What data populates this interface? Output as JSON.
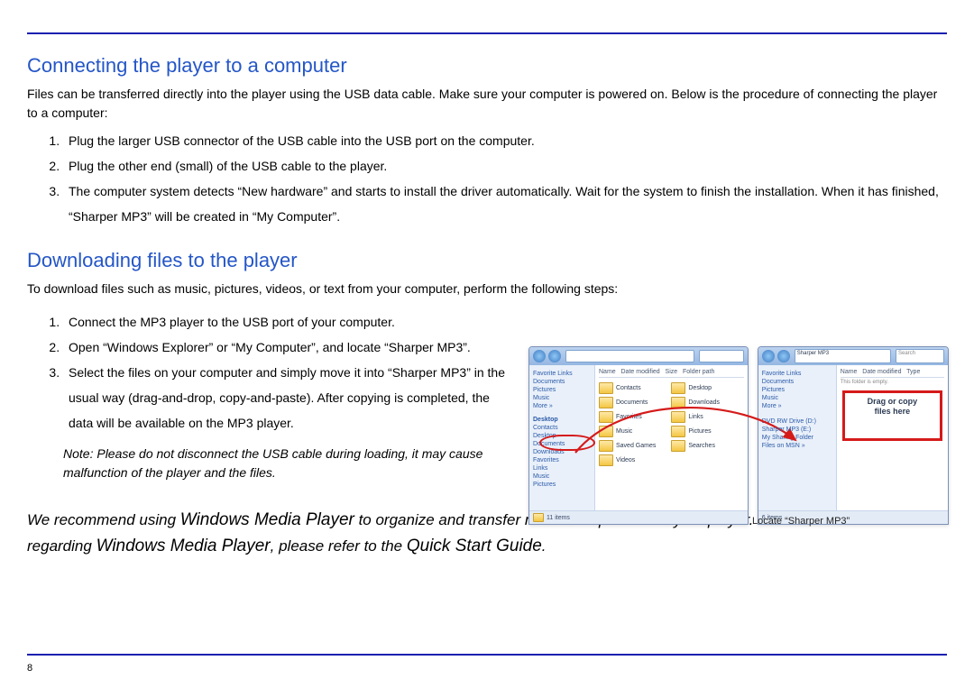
{
  "page_number": "8",
  "section1": {
    "heading": "Connecting the player to a computer",
    "intro": "Files can be transferred directly into the player using the USB data cable. Make sure your computer is powered on. Below is the procedure of connecting the player to a computer:",
    "steps": [
      "Plug the larger USB connector of the USB cable into the USB port on the computer.",
      "Plug the other end (small) of the USB cable to the player.",
      "The computer system detects “New hardware” and starts to install the driver automatically. Wait for the system to finish the installation. When it has finished, “Sharper MP3” will be created in “My Computer”."
    ]
  },
  "section2": {
    "heading": "Downloading files to the player",
    "intro": "To download files such as music, pictures, videos, or text from your computer, perform the following steps:",
    "steps": [
      "Connect the MP3 player to the USB port of your computer.",
      "Open “Windows Explorer” or “My Computer”, and locate “Sharper MP3”.",
      "Select the files on your computer and simply move it into “Sharper MP3” in the usual way (drag-and-drop, copy-and-paste).  After copying is completed, the data will be available on the MP3 player."
    ],
    "note_label": "Note:",
    "note_body": " Please do not disconnect the USB cable during loading, it  may cause malfunction of the player and the files."
  },
  "recommend": {
    "pre": "We recommend using ",
    "wmp1": "Windows Media Player",
    "mid1": " to organize and transfer music and pictures to your player. For more information regarding ",
    "wmp2": "Windows Media Player",
    "mid2": ", please refer to the ",
    "qsg": "Quick Start Guide",
    "tail": "."
  },
  "screenshot": {
    "sidebar_items": [
      "Favorite Links",
      "Documents",
      "Pictures",
      "Music",
      "More »"
    ],
    "tree_items": [
      "Desktop",
      "Contacts",
      "Desktop",
      "Documents",
      "Downloads",
      "Favorites",
      "Links",
      "Music",
      "Pictures"
    ],
    "col_headers": "Name   Date modified   Size   Folder path",
    "col_headers2": "Name   Date modified   Type",
    "folders_left": [
      "Contacts",
      "Desktop",
      "Documents",
      "Downloads",
      "Favorites",
      "Links",
      "Music",
      "Pictures",
      "Saved Games",
      "Searches",
      "Videos"
    ],
    "status_left": "11 items",
    "status_right": "6 items",
    "right_sidebar": [
      "Favorite Links",
      "Documents",
      "Pictures",
      "Music",
      "More »"
    ],
    "right_tree": [
      "DVD RW Drive (D:)",
      "Sharper MP3 (E:)",
      "My Sharing Folder",
      "Files on MSN »"
    ],
    "drag_label_l1": "Drag or copy",
    "drag_label_l2": "files here",
    "locate_caption": "Locate “Sharper MP3”",
    "addr_right": "Sharper MP3",
    "search_ph": "Search"
  }
}
